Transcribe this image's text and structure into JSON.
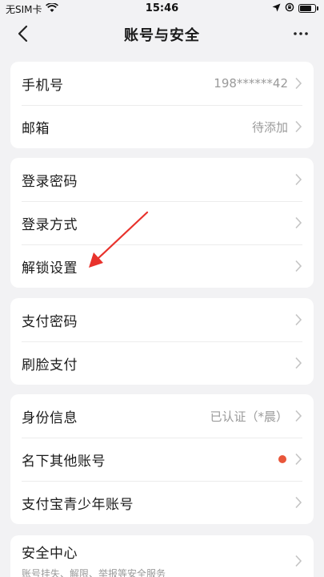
{
  "status_bar": {
    "carrier": "无SIM卡",
    "time": "15:46",
    "battery_level_percent": 80
  },
  "header": {
    "title": "账号与安全",
    "back_icon": "chevron-left-icon",
    "more_icon": "more-dots-icon"
  },
  "groups": [
    {
      "rows": [
        {
          "label": "手机号",
          "value": "198******42"
        },
        {
          "label": "邮箱",
          "value": "待添加"
        }
      ]
    },
    {
      "rows": [
        {
          "label": "登录密码"
        },
        {
          "label": "登录方式"
        },
        {
          "label": "解锁设置"
        }
      ]
    },
    {
      "rows": [
        {
          "label": "支付密码"
        },
        {
          "label": "刷脸支付"
        }
      ]
    },
    {
      "rows": [
        {
          "label": "身份信息",
          "value": "已认证（*晨）"
        },
        {
          "label": "名下其他账号",
          "badge": "red-dot"
        },
        {
          "label": "支付宝青少年账号"
        }
      ]
    },
    {
      "rows": [
        {
          "label": "安全中心",
          "sub": "账号挂失、解限、举报等安全服务"
        }
      ]
    }
  ],
  "colors": {
    "background": "#f2f2f4",
    "card": "#ffffff",
    "annotation_arrow": "#e8322c",
    "badge_dot": "#e9563a"
  }
}
